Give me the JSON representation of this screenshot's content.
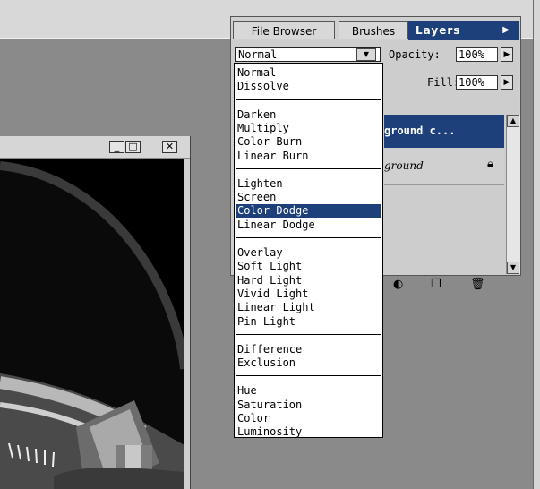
{
  "tabs": {
    "file_browser": "File Browser",
    "brushes": "Brushes",
    "layers": "Layers"
  },
  "layers_panel": {
    "blend_mode_value": "Normal",
    "opacity_label": "Opacity:",
    "opacity_value": "100%",
    "fill_label": "Fill:",
    "fill_value": "100%",
    "selected_layer_name": "ground c...",
    "background_layer_name": "ground"
  },
  "blend_menu": {
    "groups": [
      [
        "Normal",
        "Dissolve"
      ],
      [
        "Darken",
        "Multiply",
        "Color Burn",
        "Linear Burn"
      ],
      [
        "Lighten",
        "Screen",
        "Color Dodge",
        "Linear Dodge"
      ],
      [
        "Overlay",
        "Soft Light",
        "Hard Light",
        "Vivid Light",
        "Linear Light",
        "Pin Light"
      ],
      [
        "Difference",
        "Exclusion"
      ],
      [
        "Hue",
        "Saturation",
        "Color",
        "Luminosity"
      ]
    ],
    "highlighted": "Color Dodge"
  },
  "image_window": {
    "minimize": "_",
    "maximize": "□",
    "close": "✕"
  },
  "colors": {
    "highlight": "#1d3f7a",
    "workspace": "#8a8a8a",
    "panel": "#d0d0d0"
  }
}
